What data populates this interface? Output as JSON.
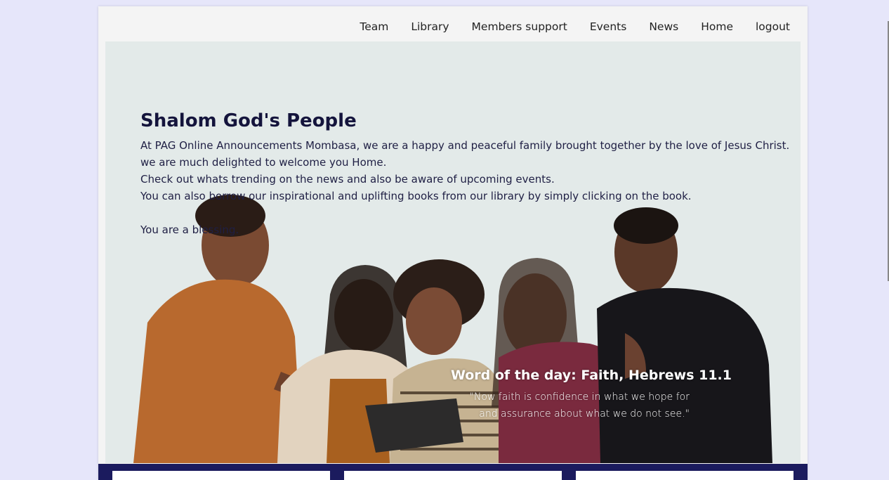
{
  "nav": {
    "items": [
      "Team",
      "Library",
      "Members support",
      "Events",
      "News",
      "Home",
      "logout"
    ]
  },
  "hero": {
    "title": "Shalom God's People",
    "lines": [
      "At PAG Online Announcements Mombasa, we are a happy and peaceful family brought together by the love of Jesus Christ.",
      "we are much delighted to welcome you Home.",
      "Check out whats trending on the news and also be aware of upcoming events.",
      "You can also borrow our inspirational and uplifting books from our library by simply clicking on the book.",
      "",
      "You are a blessing."
    ]
  },
  "word_of_day": {
    "title": "Word of the day: Faith, Hebrews 11.1",
    "verse": "\"Now faith is confidence in what we hope for and assurance about what we do not see.\""
  },
  "colors": {
    "background": "#e6e6fa",
    "band": "#1b1b5e",
    "title": "#14143c"
  }
}
